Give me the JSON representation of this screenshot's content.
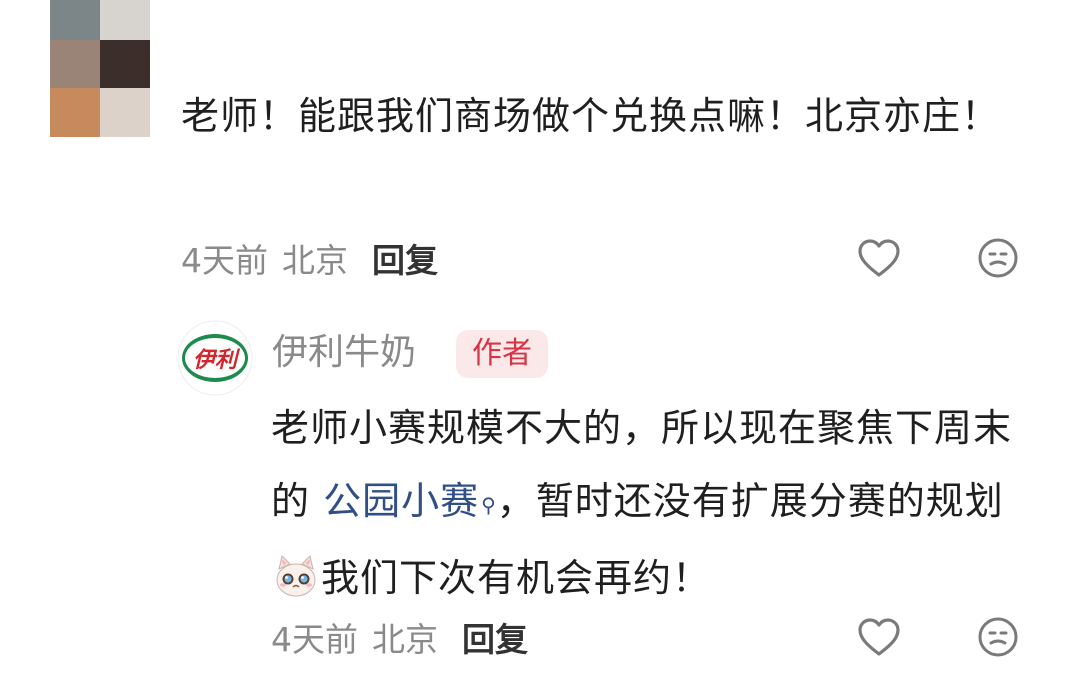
{
  "comment": {
    "text": "老师！能跟我们商场做个兑换点嘛！北京亦庄！",
    "time": "4天前",
    "location": "北京",
    "reply_label": "回复"
  },
  "reply": {
    "author": "伊利牛奶",
    "badge": "作者",
    "brand_logo_text": "伊利",
    "text_part1": "老师小赛规模不大的，所以现在聚焦下周末的 ",
    "link_text": "公园小赛",
    "text_part2": "，暂时还没有扩展分赛的规划",
    "text_part3": "我们下次有机会再约！",
    "time": "4天前",
    "location": "北京",
    "reply_label": "回复"
  },
  "icons": {
    "like": "heart-outline-icon",
    "dislike": "neutral-face-icon",
    "link_search": "search-icon",
    "emoji": "crying-cat-emoji"
  },
  "colors": {
    "link": "#2f4f86",
    "badge_bg": "#fbe9ea",
    "badge_text": "#d63447",
    "brand_green": "#1e8a4c",
    "brand_red": "#d3252c"
  }
}
